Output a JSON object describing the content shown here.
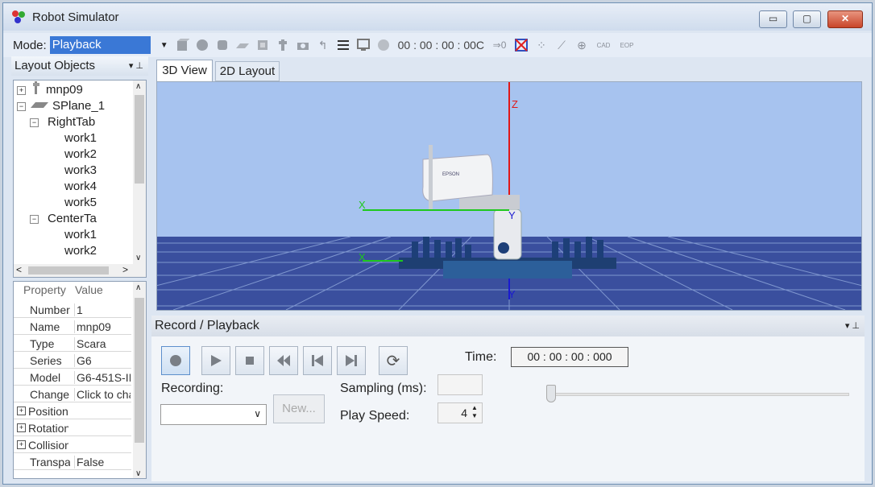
{
  "window": {
    "title": "Robot Simulator",
    "minimize": "▭",
    "maximize": "▢",
    "close": "✕"
  },
  "toolbar": {
    "mode_label": "Mode:",
    "mode_value": "Playback",
    "time": "00 : 00 : 00 : 00C",
    "icons": [
      "box-icon",
      "sphere-icon",
      "cylinder-icon",
      "plane-icon",
      "part-icon",
      "robot-icon",
      "camera-icon",
      "undo-icon",
      "list-icon",
      "monitor-icon",
      "globe-icon"
    ],
    "icons2": [
      "arrow-zero-icon",
      "collision-icon",
      "scatter-icon",
      "link-icon",
      "target-icon",
      "cad-icon",
      "eop-icon"
    ],
    "arrow_zero": "⇒0",
    "cad": "CAD",
    "eop": "EOP"
  },
  "layout_panel": {
    "title": "Layout Objects",
    "tree": [
      {
        "label": "mnp09",
        "level": 0,
        "icon": "robot-icon",
        "expander": "+"
      },
      {
        "label": "SPlane_1",
        "level": 0,
        "icon": "plane-icon",
        "expander": "−"
      },
      {
        "label": "RightTab",
        "level": 1,
        "icon": "cube-icon",
        "expander": "−"
      },
      {
        "label": "work1",
        "level": 2,
        "icon": "cylinder-icon"
      },
      {
        "label": "work2",
        "level": 2,
        "icon": "cylinder-icon"
      },
      {
        "label": "work3",
        "level": 2,
        "icon": "cylinder-icon"
      },
      {
        "label": "work4",
        "level": 2,
        "icon": "cylinder-icon"
      },
      {
        "label": "work5",
        "level": 2,
        "icon": "cylinder-icon"
      },
      {
        "label": "CenterTa",
        "level": 1,
        "icon": "cube-icon",
        "expander": "−"
      },
      {
        "label": "work1",
        "level": 2,
        "icon": "sphere-icon"
      },
      {
        "label": "work2",
        "level": 2,
        "icon": "sphere-icon"
      }
    ]
  },
  "properties": {
    "header_property": "Property",
    "header_value": "Value",
    "rows": [
      {
        "name": "Number",
        "value": "1"
      },
      {
        "name": "Name",
        "value": "mnp09"
      },
      {
        "name": "Type",
        "value": "Scara"
      },
      {
        "name": "Series",
        "value": "G6"
      },
      {
        "name": "Model",
        "value": "G6-451S-II"
      },
      {
        "name": "Change I",
        "value": "Click to cha"
      },
      {
        "name": "Position",
        "value": "",
        "expander": "+"
      },
      {
        "name": "Rotation",
        "value": "",
        "expander": "+"
      },
      {
        "name": "Collision",
        "value": "",
        "expander": "+"
      },
      {
        "name": "Transpar",
        "value": "False"
      }
    ]
  },
  "tabs": {
    "view3d": "3D View",
    "layout2d": "2D Layout"
  },
  "viewport": {
    "axis_z": "Z",
    "axis_x": "X",
    "axis_y": "Y",
    "axis_x2": "X",
    "axis_y2": "Y",
    "robot_brand": "EPSON",
    "colors": {
      "sky": "#a7c3ef",
      "floor": "#3a4f9e",
      "grid": "#7f97cf",
      "table": "#2c5f9a",
      "z_axis": "#e01818",
      "x_axis": "#1ec81e",
      "y_axis": "#1a1ad0"
    }
  },
  "record_panel": {
    "title": "Record / Playback",
    "recording_label": "Recording:",
    "new_button": "New...",
    "sampling_label": "Sampling (ms):",
    "sampling_value": "",
    "play_speed_label": "Play Speed:",
    "play_speed_value": "4",
    "time_label": "Time:",
    "time_value": "00 : 00 : 00 : 000",
    "slider_position": 0
  }
}
